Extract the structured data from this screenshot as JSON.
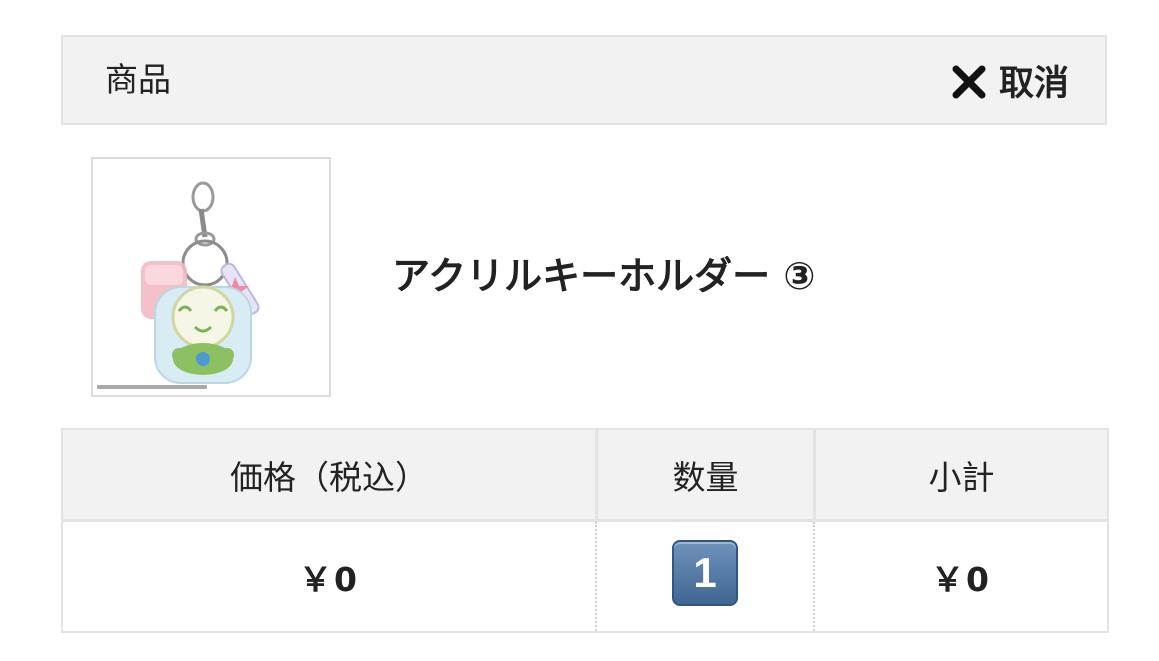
{
  "header": {
    "title": "商品",
    "cancel_label": "取消",
    "cancel_icon": "close-icon"
  },
  "product": {
    "name": "アクリルキーホルダー ③",
    "thumbnail_icon": "acrylic-keychain-image"
  },
  "table": {
    "headers": [
      "価格（税込）",
      "数量",
      "小計"
    ],
    "row": {
      "price": "￥0",
      "quantity": "1",
      "subtotal": "￥0"
    }
  },
  "colors": {
    "header_bg": "#f2f2f2",
    "border": "#e3e3e3",
    "badge": "#4a72a0"
  }
}
